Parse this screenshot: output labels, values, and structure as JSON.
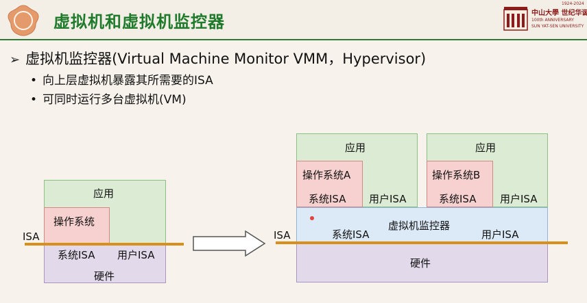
{
  "header": {
    "title": "虚拟机和虚拟机监控器",
    "logo": {
      "name_cn": "中山大學 世纪华诞",
      "line1": "100th ANNIVERSARY",
      "line2": "SUN YAT-SEN UNIVERSITY",
      "years": "1924-2024"
    }
  },
  "content": {
    "bullet": "虚拟机监控器(Virtual Machine Monitor VMM，Hypervisor)",
    "sub_bullets": [
      "向上层虚拟机暴露其所需要的ISA",
      "可同时运行多台虚拟机(VM)"
    ]
  },
  "diagram_left": {
    "app": "应用",
    "os": "操作系统",
    "isa": "ISA",
    "sys_isa": "系统ISA",
    "user_isa": "用户ISA",
    "hardware": "硬件"
  },
  "diagram_right": {
    "vm_a": {
      "app": "应用",
      "os": "操作系统A",
      "sys_isa": "系统ISA",
      "user_isa": "用户ISA"
    },
    "vm_b": {
      "app": "应用",
      "os": "操作系统B",
      "sys_isa": "系统ISA",
      "user_isa": "用户ISA"
    },
    "vmm": "虚拟机监控器",
    "vmm_sys_isa": "系统ISA",
    "vmm_user_isa": "用户ISA",
    "isa": "ISA",
    "hardware": "硬件"
  },
  "colors": {
    "title_green": "#1f7a2c",
    "isa_line": "#d88f1c",
    "app_green": "#dcebd4",
    "os_pink": "#f7d1cf",
    "hardware_purple": "#e2d9ea",
    "vmm_blue": "#dce9f6",
    "badge_orange": "#e59a6b"
  }
}
